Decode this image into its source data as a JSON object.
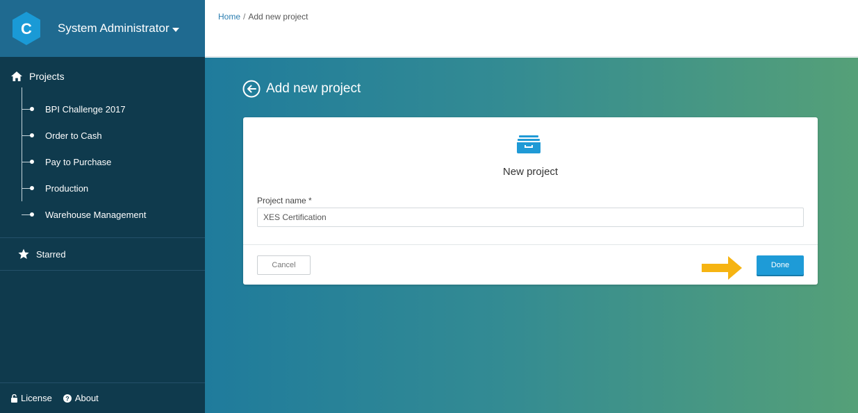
{
  "sidebar": {
    "user_name": "System Administrator",
    "projects_label": "Projects",
    "project_items": [
      {
        "label": "BPI Challenge 2017"
      },
      {
        "label": "Order to Cash"
      },
      {
        "label": "Pay to Purchase"
      },
      {
        "label": "Production"
      },
      {
        "label": "Warehouse Management"
      }
    ],
    "starred_label": "Starred",
    "footer": {
      "license_label": "License",
      "about_label": "About"
    }
  },
  "logo": {
    "letter": "C"
  },
  "breadcrumb": {
    "home": "Home",
    "separator": "/",
    "current": "Add new project"
  },
  "page": {
    "title": "Add new project"
  },
  "card": {
    "title": "New project",
    "field_label": "Project name *",
    "field_value": "XES Certification",
    "cancel_label": "Cancel",
    "done_label": "Done"
  },
  "colors": {
    "sidebar_bg": "#0f3a4d",
    "sidebar_header_bg": "#1f6a90",
    "accent": "#1e9bd7",
    "annotation_arrow": "#f6b412"
  },
  "icons": {
    "logo": "hexagon-c-logo",
    "projects": "home-icon",
    "starred": "star-icon",
    "license": "lock-icon",
    "about": "question-circle-icon",
    "back": "back-circle-arrow-icon",
    "card": "archive-box-icon",
    "annotation": "right-arrow-annotation"
  }
}
